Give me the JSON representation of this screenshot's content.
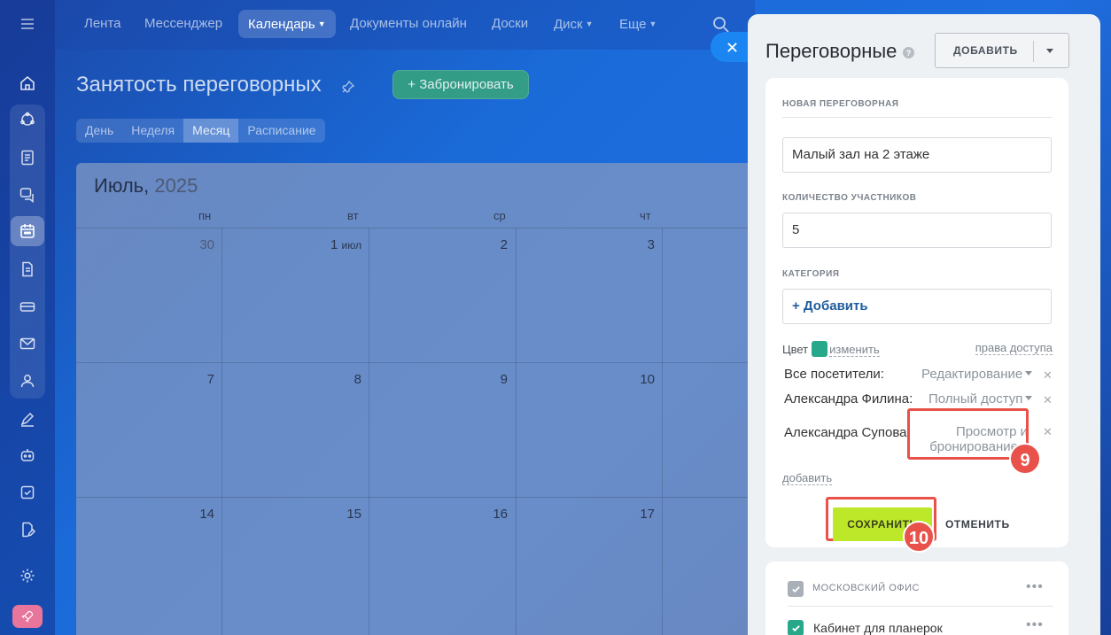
{
  "nav": {
    "items": [
      "Лента",
      "Мессенджер",
      "Календарь",
      "Документы онлайн",
      "Доски",
      "Диск",
      "Еще"
    ]
  },
  "page": {
    "title": "Занятость переговорных",
    "book_button": "Забронировать",
    "view_tabs": [
      "День",
      "Неделя",
      "Месяц",
      "Расписание"
    ],
    "active_tab": "Месяц"
  },
  "calendar": {
    "month": "Июль,",
    "year": "2025",
    "weekdays": [
      "пн",
      "вт",
      "ср",
      "чт"
    ],
    "weeks": [
      [
        "30",
        "1",
        "2",
        "3"
      ],
      [
        "7",
        "8",
        "9",
        "10"
      ],
      [
        "14",
        "15",
        "16",
        "17"
      ]
    ],
    "month_suffix": "июл"
  },
  "panel": {
    "title": "Переговорные",
    "add_button": "ДОБАВИТЬ",
    "new_room_label": "НОВАЯ ПЕРЕГОВОРНАЯ",
    "room_name_value": "Малый зал на 2 этаже",
    "participants_label": "КОЛИЧЕСТВО УЧАСТНИКОВ",
    "participants_value": "5",
    "category_label": "КАТЕГОРИЯ",
    "category_add": "+ Добавить",
    "color_label": "Цвет",
    "color_change": "изменить",
    "color_value": "#28a88a",
    "access_link": "права доступа",
    "permissions": [
      {
        "name": "Все посетители:",
        "value": "Редактирование"
      },
      {
        "name": "Александра Филина:",
        "value": "Полный доступ"
      },
      {
        "name": "Александра Супова:",
        "value_line1": "Просмотр и",
        "value_line2": "бронирование"
      }
    ],
    "add_access": "добавить",
    "save": "СОХРАНИТЬ",
    "cancel": "ОТМЕНИТЬ",
    "badge_9": "9",
    "badge_10": "10",
    "office_label": "МОСКОВСКИЙ ОФИС",
    "room_item": "Кабинет для планерок"
  },
  "colors": {
    "accent_green": "#bde82a",
    "highlight_red": "#e8524a",
    "brand_blue": "#1b86f2"
  }
}
